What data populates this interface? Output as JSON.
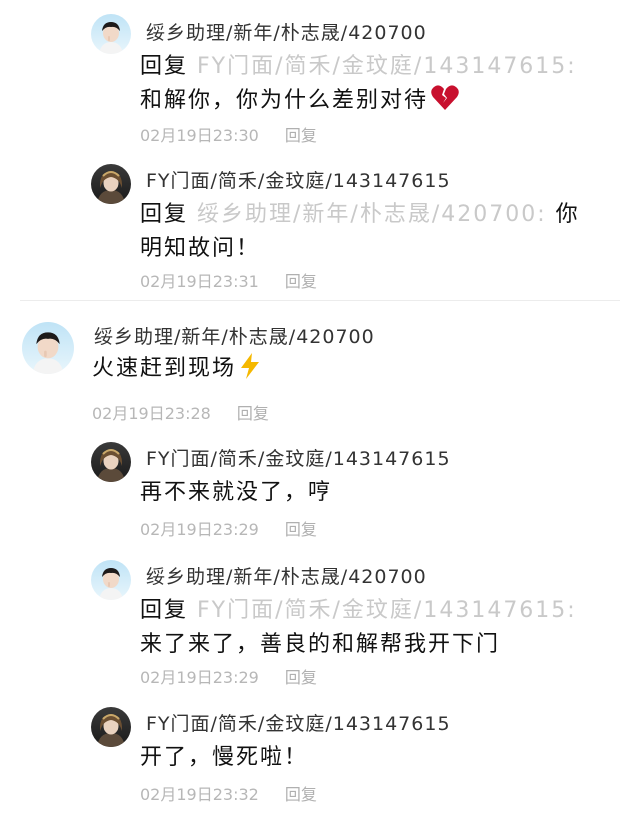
{
  "comments": [
    {
      "username": "绥乡助理/新年/朴志晟/420700",
      "reply_prefix": "回复 ",
      "reply_target": "FY门面/简禾/金玟庭/143147615:",
      "line2": "和解你，你为什么差别对待",
      "emoji": "broken-heart-icon",
      "time": "02月19日23:30",
      "reply_label": "回复"
    },
    {
      "username": "FY门面/简禾/金玟庭/143147615",
      "reply_prefix": "回复 ",
      "reply_target": "绥乡助理/新年/朴志晟/420700:",
      "reply_tail": " 你",
      "line2": "明知故问！",
      "time": "02月19日23:31",
      "reply_label": "回复"
    },
    {
      "username": "绥乡助理/新年/朴志晟/420700",
      "line1": "火速赶到现场",
      "emoji": "lightning-icon",
      "time": "02月19日23:28",
      "reply_label": "回复"
    },
    {
      "username": "FY门面/简禾/金玟庭/143147615",
      "line1": "再不来就没了，哼",
      "time": "02月19日23:29",
      "reply_label": "回复"
    },
    {
      "username": "绥乡助理/新年/朴志晟/420700",
      "reply_prefix": "回复 ",
      "reply_target": "FY门面/简禾/金玟庭/143147615:",
      "line2": "来了来了，善良的和解帮我开下门",
      "time": "02月19日23:29",
      "reply_label": "回复"
    },
    {
      "username": "FY门面/简禾/金玟庭/143147615",
      "line1": "开了，慢死啦！",
      "time": "02月19日23:32",
      "reply_label": "回复"
    }
  ],
  "colors": {
    "meta_text": "#b7b7b7",
    "reply_target": "#c9c9c9",
    "divider": "#ececec"
  }
}
